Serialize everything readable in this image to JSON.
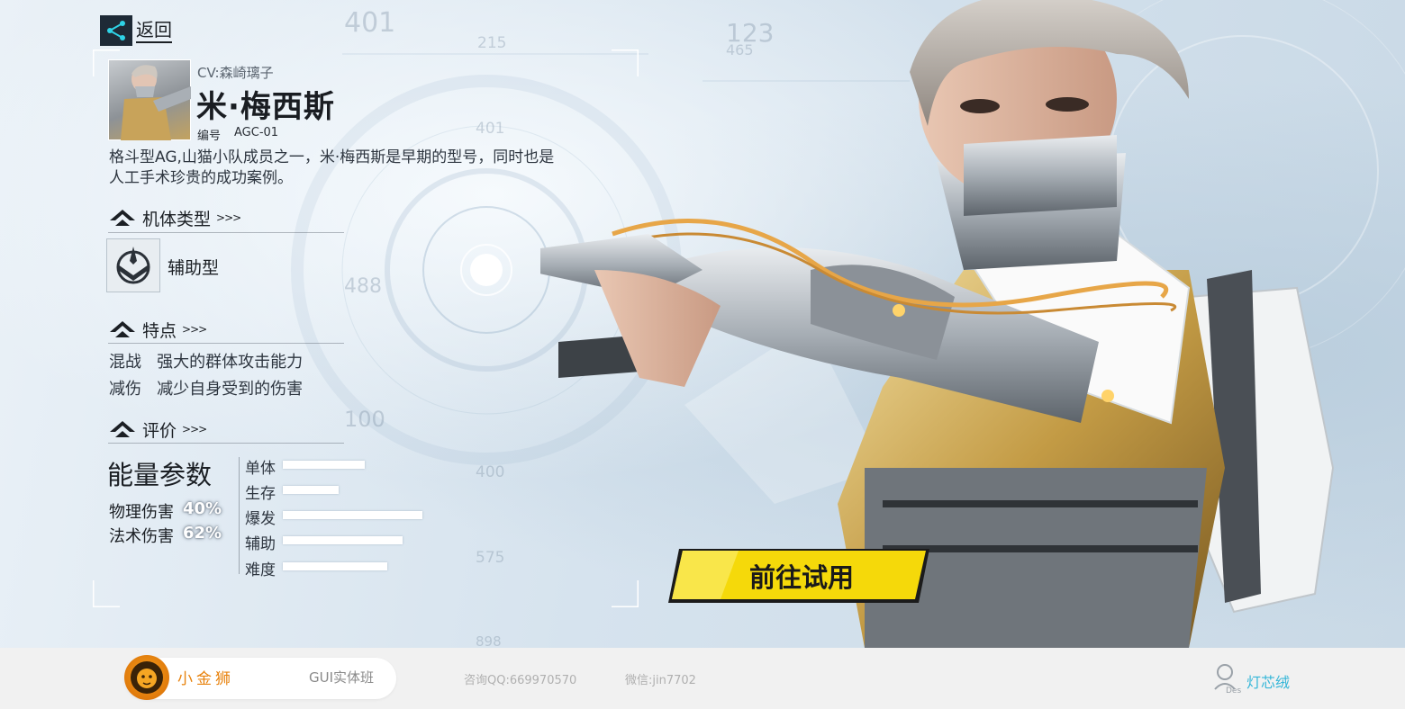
{
  "nav": {
    "back_label": "返回"
  },
  "character": {
    "cv": "CV:森崎璃子",
    "name": "米·梅西斯",
    "code_label": "编号",
    "code_value": "AGC-01",
    "description": "格斗型AG,山猫小队成员之一，米·梅西斯是早期的型号，同时也是人工手术珍贵的成功案例。"
  },
  "sections": {
    "body_type": {
      "title": "机体类型",
      "value": "辅助型"
    },
    "features": {
      "title": "特点",
      "items": [
        {
          "name": "混战",
          "text": "强大的群体攻击能力"
        },
        {
          "name": "减伤",
          "text": "减少自身受到的伤害"
        }
      ]
    },
    "rating": {
      "title": "评价",
      "energy_title": "能量参数",
      "damage": [
        {
          "label": "物理伤害",
          "value": "40%"
        },
        {
          "label": "法术伤害",
          "value": "62%"
        }
      ],
      "stats": [
        {
          "label": "单体",
          "level": 0.59
        },
        {
          "label": "生存",
          "level": 0.4
        },
        {
          "label": "爆发",
          "level": 1.0
        },
        {
          "label": "辅助",
          "level": 0.86
        },
        {
          "label": "难度",
          "level": 0.75
        }
      ]
    }
  },
  "cta": {
    "try_label": "前往试用"
  },
  "background_numbers": [
    "401",
    "123",
    "465",
    "215",
    "401",
    "488",
    "100",
    "400",
    "575",
    "898"
  ],
  "footer": {
    "brand_name": "小金狮",
    "course": "GUI实体班",
    "qq": "咨询QQ:669970570",
    "wechat": "微信:jin7702",
    "author_tag": "Des",
    "author": "灯芯绒"
  },
  "colors": {
    "accent_yellow": "#f5d90a",
    "brand_orange": "#e8830e",
    "author_cyan": "#35b6d8",
    "panel_dark": "#1e2a36"
  }
}
